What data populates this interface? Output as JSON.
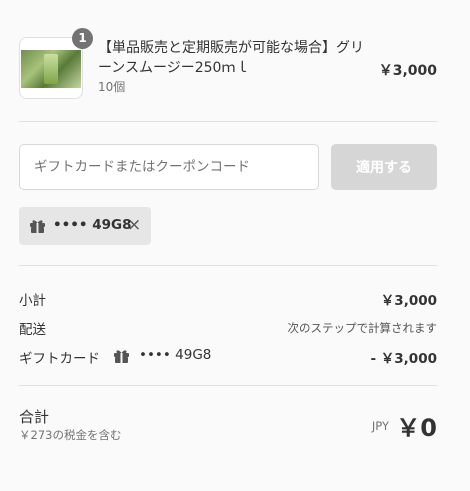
{
  "product": {
    "name": "【単品販売と定期販売が可能な場合】グリーンスムージー250ｍｌ",
    "quantity_badge": "1",
    "variant": "10個",
    "price": "￥3,000"
  },
  "discount": {
    "placeholder": "ギフトカードまたはクーポンコード",
    "apply_label": "適用する",
    "applied_code": "•••• 49G8",
    "remove_icon": "×"
  },
  "summary": {
    "subtotal_label": "小計",
    "subtotal_value": "￥3,000",
    "shipping_label": "配送",
    "shipping_value": "次のステップで計算されます",
    "giftcard_label": "ギフトカード",
    "giftcard_code": "•••• 49G8",
    "giftcard_value": "- ￥3,000"
  },
  "total": {
    "label": "合計",
    "tax_note": "￥273の税金を含む",
    "currency": "JPY",
    "value": "￥0"
  },
  "colors": {
    "badge": "#737373",
    "apply_button_disabled": "#d6d6d6",
    "tag_background": "#e6e6e6",
    "divider": "#e1e1e1"
  },
  "icons": [
    "gift-icon",
    "close-icon"
  ]
}
